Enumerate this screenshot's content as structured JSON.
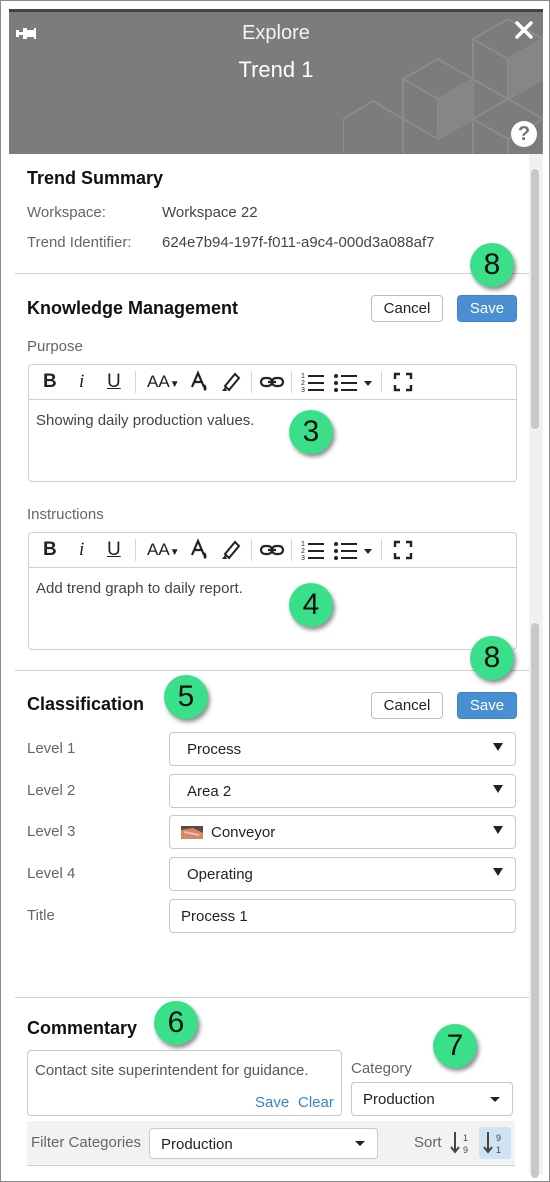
{
  "header": {
    "title": "Explore",
    "subtitle": "Trend 1",
    "help_label": "?"
  },
  "trend_summary": {
    "title": "Trend Summary",
    "workspace_label": "Workspace:",
    "workspace_value": "Workspace 22",
    "identifier_label": "Trend Identifier:",
    "identifier_value": "624e7b94-197f-f011-a9c4-000d3a088af7"
  },
  "knowledge": {
    "title": "Knowledge Management",
    "cancel_label": "Cancel",
    "save_label": "Save",
    "purpose_label": "Purpose",
    "purpose_text": "Showing daily production values.",
    "instructions_label": "Instructions",
    "instructions_text": "Add trend graph to daily report."
  },
  "toolbar": {
    "bold": "B",
    "italic": "i",
    "underline": "U",
    "font_size": "AA"
  },
  "classification": {
    "title": "Classification",
    "cancel_label": "Cancel",
    "save_label": "Save",
    "level1_label": "Level 1",
    "level1_value": "Process",
    "level2_label": "Level 2",
    "level2_value": "Area 2",
    "level3_label": "Level 3",
    "level3_value": "Conveyor",
    "level4_label": "Level 4",
    "level4_value": "Operating",
    "title_label": "Title",
    "title_value": "Process 1"
  },
  "commentary": {
    "title": "Commentary",
    "comment_text": "Contact site superintendent for guidance.",
    "save_link": "Save",
    "clear_link": "Clear",
    "category_label": "Category",
    "category_value": "Production",
    "filter_label": "Filter Categories",
    "filter_value": "Production",
    "sort_label": "Sort"
  },
  "callouts": {
    "badge_8a": "8",
    "badge_3": "3",
    "badge_4": "4",
    "badge_8b": "8",
    "badge_5": "5",
    "badge_6": "6",
    "badge_7": "7"
  },
  "colors": {
    "header_bg": "#7c7c7c",
    "accent": "#4a8fd4",
    "callout": "#3ae089",
    "link": "#3a83c9"
  },
  "icons": [
    "pin-icon",
    "close-icon",
    "help-icon",
    "text-color-icon",
    "highlighter-icon",
    "link-icon",
    "numbered-list-icon",
    "bullet-list-icon",
    "fullscreen-icon",
    "conveyor-icon",
    "sort-ascending-icon",
    "sort-descending-icon"
  ]
}
